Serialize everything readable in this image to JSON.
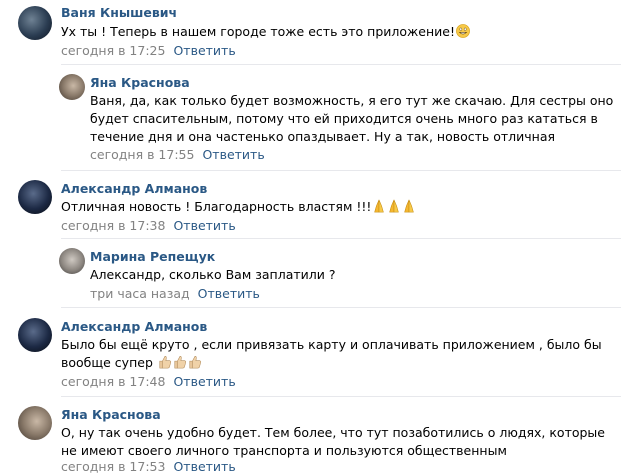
{
  "comments": [
    {
      "author": "Ваня Кнышевич",
      "text": "Ух ты ! Теперь в нашем городе тоже есть это приложение!",
      "time": "сегодня в 17:25",
      "reply": "Ответить",
      "emoji": [
        "grinning-face"
      ]
    },
    {
      "author": "Яна Краснова",
      "text": "Ваня, да, как только будет возможность, я его тут же скачаю. Для сестры оно будет спасительным, потому что ей приходится очень много раз кататься в течение дня и она частенько опаздывает. Ну а так, новость отличная",
      "time": "сегодня в 17:55",
      "reply": "Ответить"
    },
    {
      "author": "Александр Алманов",
      "text": "Отличная новость ! Благодарность властям !!!",
      "time": "сегодня в 17:38",
      "reply": "Ответить",
      "emoji": [
        "folded-hands",
        "folded-hands",
        "folded-hands"
      ]
    },
    {
      "author": "Марина Репещук",
      "text": "Александр, сколько Вам заплатили ?",
      "time": "три часа назад",
      "reply": "Ответить"
    },
    {
      "author": "Александр Алманов",
      "text": "Было бы ещё круто , если привязать карту и оплачивать приложением , было бы вообще супер",
      "time": "сегодня в 17:48",
      "reply": "Ответить",
      "emoji": [
        "thumbs-up",
        "thumbs-up",
        "thumbs-up"
      ]
    },
    {
      "author": "Яна Краснова",
      "text": "О, ну так очень удобно будет. Тем более, что тут позаботились о людях, которые не имеют своего личного транспорта и пользуются общественным",
      "time": "сегодня в 17:53",
      "reply": "Ответить"
    }
  ],
  "colors": {
    "author": "#2a5885",
    "meta": "#828282",
    "divider": "#e7e8ec"
  }
}
